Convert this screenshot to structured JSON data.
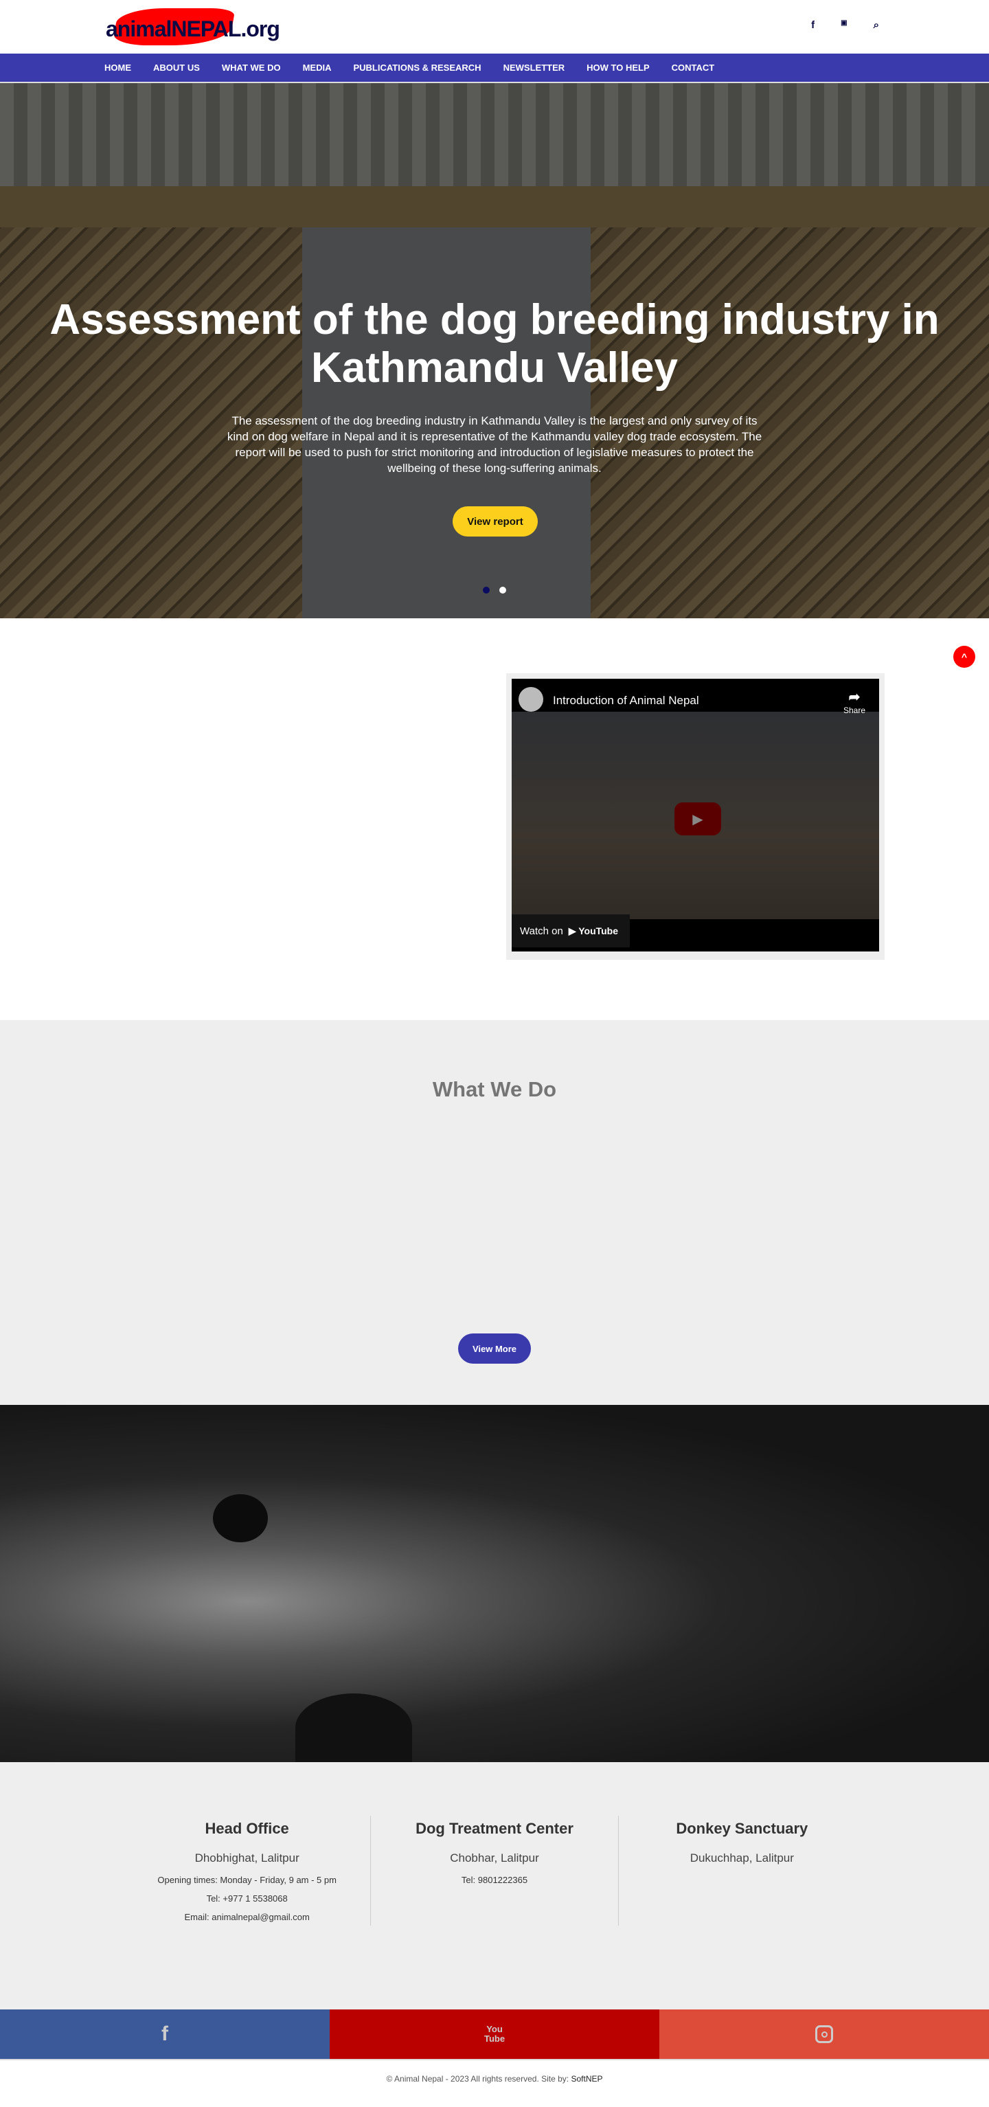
{
  "header": {
    "logo_text": "animalNEPAL.org",
    "icons": [
      "facebook-icon",
      "youtube-icon",
      "search-icon"
    ]
  },
  "nav": {
    "items": [
      "HOME",
      "ABOUT US",
      "WHAT WE DO",
      "MEDIA",
      "PUBLICATIONS & RESEARCH",
      "NEWSLETTER",
      "HOW TO HELP",
      "CONTACT"
    ]
  },
  "hero": {
    "title": "Assessment of the dog breeding industry in Kathmandu Valley",
    "text": "The assessment of the dog breeding industry in Kathmandu Valley is the largest and only survey of its kind on dog welfare in Nepal and it is representative of the Kathmandu valley dog trade ecosystem. The report will be used to push for strict monitoring and introduction of legislative measures to protect the wellbeing of these long-suffering animals.",
    "button": "View report",
    "slides": 2,
    "active_slide": 1,
    "button_color": "#fccf1c"
  },
  "video": {
    "title": "Introduction of Animal Nepal",
    "share": "Share",
    "watch_on": "Watch on",
    "youtube": "YouTube"
  },
  "what_we_do": {
    "title": "What We Do",
    "button": "View More"
  },
  "footer": {
    "columns": [
      {
        "title": "Head Office",
        "address": "Dhobhighat, Lalitpur",
        "lines": [
          "Opening times: Monday - Friday, 9 am - 5 pm",
          "Tel: +977 1 5538068",
          "Email: animalnepal@gmail.com"
        ]
      },
      {
        "title": "Dog Treatment Center",
        "address": "Chobhar, Lalitpur",
        "lines": [
          "Tel: 9801222365"
        ]
      },
      {
        "title": "Donkey Sanctuary",
        "address": "Dukuchhap, Lalitpur",
        "lines": []
      }
    ]
  },
  "social": {
    "facebook": {
      "color": "#3b5998"
    },
    "youtube": {
      "color": "#bb0000",
      "label": "You Tube"
    },
    "instagram": {
      "color": "#dd4b39"
    }
  },
  "copyright": {
    "text": "© Animal Nepal - 2023 All rights reserved. Site by: ",
    "site": "SoftNEP"
  },
  "colors": {
    "nav": "#3a3aad",
    "scroll_top": "#ff0000"
  }
}
